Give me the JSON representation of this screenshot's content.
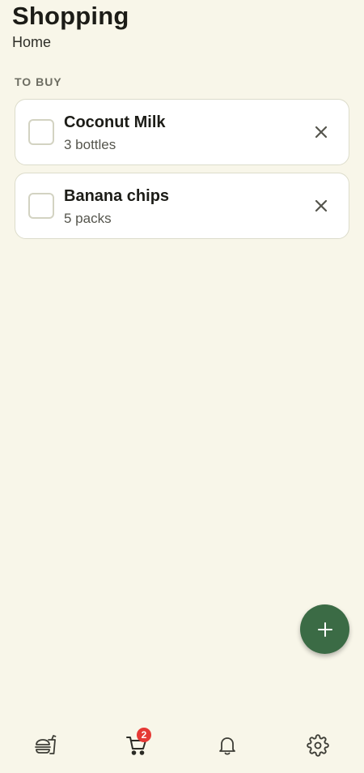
{
  "header": {
    "title": "Shopping",
    "subtitle": "Home"
  },
  "section": {
    "label": "TO BUY"
  },
  "items": [
    {
      "name": "Coconut Milk",
      "quantity": "3 bottles"
    },
    {
      "name": "Banana chips",
      "quantity": "5 packs"
    }
  ],
  "fab": {
    "icon": "plus-icon"
  },
  "nav": {
    "items": [
      {
        "icon": "food-drink-icon"
      },
      {
        "icon": "cart-icon",
        "badge": "2"
      },
      {
        "icon": "bell-icon"
      },
      {
        "icon": "gear-icon"
      }
    ],
    "active_index": 1
  },
  "colors": {
    "background": "#f8f6e9",
    "accent": "#3b6b45",
    "badge": "#e53935"
  }
}
